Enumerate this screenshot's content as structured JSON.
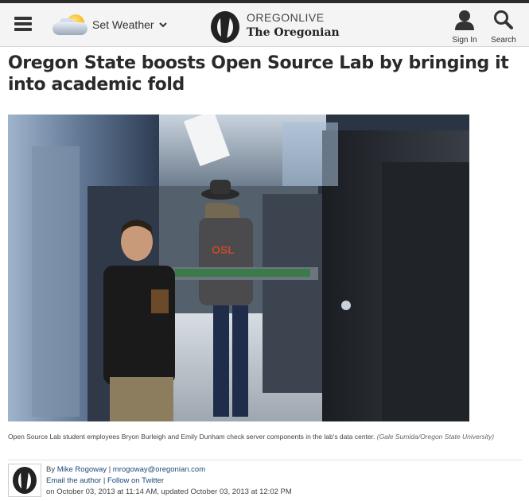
{
  "header": {
    "weather_label": "Set Weather",
    "brand_top": "OREGONLIVE",
    "brand_bottom": "The Oregonian",
    "signin_label": "Sign In",
    "search_label": "Search"
  },
  "article": {
    "headline": "Oregon State boosts Open Source Lab by bringing it into academic fold",
    "caption_text": "Open Source Lab student employees Bryon Burleigh and Emily Dunham check server components in the lab's data center.",
    "caption_credit": "(Gale Sumida/Oregon State University)",
    "image_tshirt_text": "OSL"
  },
  "byline": {
    "by": "By",
    "author": "Mike Rogoway",
    "email": "mrogoway@oregonian.com",
    "email_author": "Email the author",
    "follow": "Follow on Twitter",
    "date_line": "on October 03, 2013 at 11:14 AM, updated October 03, 2013 at 12:02 PM"
  },
  "colors": {
    "link": "#1a4a7a",
    "header_bg": "#f4f4f4"
  }
}
